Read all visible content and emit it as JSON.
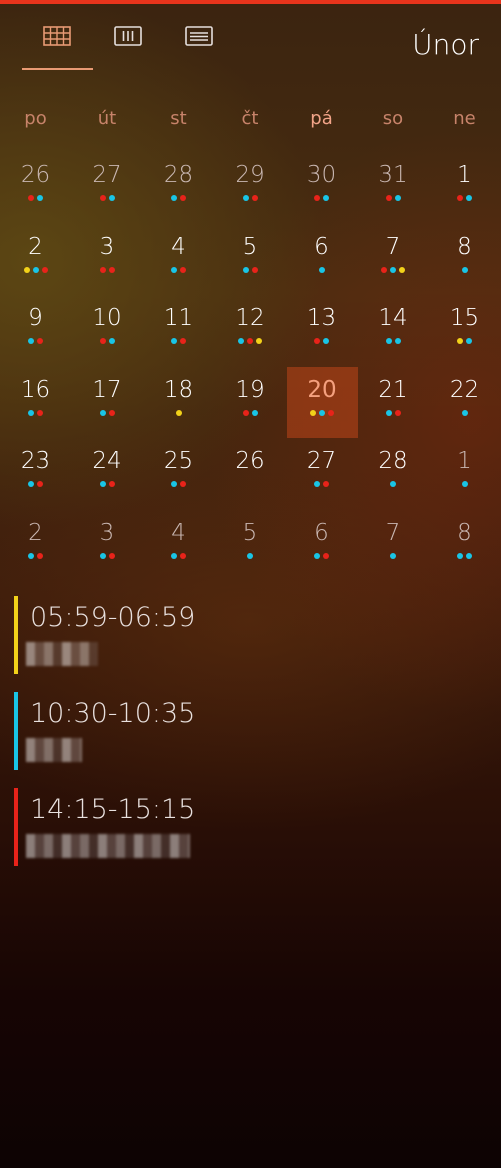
{
  "header": {
    "month": "Únor",
    "view_tabs": [
      {
        "name": "month-view-tab",
        "icon": "month-grid-icon",
        "active": true
      },
      {
        "name": "week-view-tab",
        "icon": "week-columns-icon",
        "active": false
      },
      {
        "name": "agenda-view-tab",
        "icon": "agenda-list-icon",
        "active": false
      }
    ]
  },
  "weekdays": [
    "po",
    "út",
    "st",
    "čt",
    "pá",
    "so",
    "ne"
  ],
  "colors": {
    "red": "#e8231a",
    "cyan": "#19c5e6",
    "yellow": "#f2d21a",
    "accent": "#e89a74",
    "today_bg": "#b4451c"
  },
  "weeks": [
    [
      {
        "day": "26",
        "other": true,
        "dots": [
          "red",
          "cyan"
        ]
      },
      {
        "day": "27",
        "other": true,
        "dots": [
          "red",
          "cyan"
        ]
      },
      {
        "day": "28",
        "other": true,
        "dots": [
          "cyan",
          "red"
        ]
      },
      {
        "day": "29",
        "other": true,
        "dots": [
          "cyan",
          "red"
        ]
      },
      {
        "day": "30",
        "other": true,
        "dots": [
          "red",
          "cyan"
        ]
      },
      {
        "day": "31",
        "other": true,
        "dots": [
          "red",
          "cyan"
        ]
      },
      {
        "day": "1",
        "other": false,
        "dots": [
          "red",
          "cyan"
        ]
      }
    ],
    [
      {
        "day": "2",
        "other": false,
        "dots": [
          "yellow",
          "cyan",
          "red"
        ]
      },
      {
        "day": "3",
        "other": false,
        "dots": [
          "red",
          "red"
        ]
      },
      {
        "day": "4",
        "other": false,
        "dots": [
          "cyan",
          "red"
        ]
      },
      {
        "day": "5",
        "other": false,
        "dots": [
          "cyan",
          "red"
        ]
      },
      {
        "day": "6",
        "other": false,
        "dots": [
          "cyan"
        ]
      },
      {
        "day": "7",
        "other": false,
        "dots": [
          "red",
          "cyan",
          "yellow"
        ]
      },
      {
        "day": "8",
        "other": false,
        "dots": [
          "cyan"
        ]
      }
    ],
    [
      {
        "day": "9",
        "other": false,
        "dots": [
          "cyan",
          "red"
        ]
      },
      {
        "day": "10",
        "other": false,
        "dots": [
          "red",
          "cyan"
        ]
      },
      {
        "day": "11",
        "other": false,
        "dots": [
          "cyan",
          "red"
        ]
      },
      {
        "day": "12",
        "other": false,
        "dots": [
          "cyan",
          "red",
          "yellow"
        ]
      },
      {
        "day": "13",
        "other": false,
        "dots": [
          "red",
          "cyan"
        ]
      },
      {
        "day": "14",
        "other": false,
        "dots": [
          "cyan",
          "cyan"
        ]
      },
      {
        "day": "15",
        "other": false,
        "dots": [
          "yellow",
          "cyan"
        ]
      }
    ],
    [
      {
        "day": "16",
        "other": false,
        "dots": [
          "cyan",
          "red"
        ]
      },
      {
        "day": "17",
        "other": false,
        "dots": [
          "cyan",
          "red"
        ]
      },
      {
        "day": "18",
        "other": false,
        "dots": [
          "yellow"
        ]
      },
      {
        "day": "19",
        "other": false,
        "dots": [
          "red",
          "cyan"
        ]
      },
      {
        "day": "20",
        "other": false,
        "today": true,
        "dots": [
          "yellow",
          "cyan",
          "red"
        ]
      },
      {
        "day": "21",
        "other": false,
        "dots": [
          "cyan",
          "red"
        ]
      },
      {
        "day": "22",
        "other": false,
        "dots": [
          "cyan"
        ]
      }
    ],
    [
      {
        "day": "23",
        "other": false,
        "dots": [
          "cyan",
          "red"
        ]
      },
      {
        "day": "24",
        "other": false,
        "dots": [
          "cyan",
          "red"
        ]
      },
      {
        "day": "25",
        "other": false,
        "dots": [
          "cyan",
          "red"
        ]
      },
      {
        "day": "26",
        "other": false,
        "dots": []
      },
      {
        "day": "27",
        "other": false,
        "dots": [
          "cyan",
          "red"
        ]
      },
      {
        "day": "28",
        "other": false,
        "dots": [
          "cyan"
        ]
      },
      {
        "day": "1",
        "other": true,
        "dots": [
          "cyan"
        ]
      }
    ],
    [
      {
        "day": "2",
        "other": true,
        "dots": [
          "cyan",
          "red"
        ]
      },
      {
        "day": "3",
        "other": true,
        "dots": [
          "cyan",
          "red"
        ]
      },
      {
        "day": "4",
        "other": true,
        "dots": [
          "cyan",
          "red"
        ]
      },
      {
        "day": "5",
        "other": true,
        "dots": [
          "cyan"
        ]
      },
      {
        "day": "6",
        "other": true,
        "dots": [
          "cyan",
          "red"
        ]
      },
      {
        "day": "7",
        "other": true,
        "dots": [
          "cyan"
        ]
      },
      {
        "day": "8",
        "other": true,
        "dots": [
          "cyan",
          "cyan"
        ]
      }
    ]
  ],
  "events": [
    {
      "time": "05:59-06:59",
      "color": "yellow"
    },
    {
      "time": "10:30-10:35",
      "color": "cyan"
    },
    {
      "time": "14:15-15:15",
      "color": "red"
    }
  ]
}
